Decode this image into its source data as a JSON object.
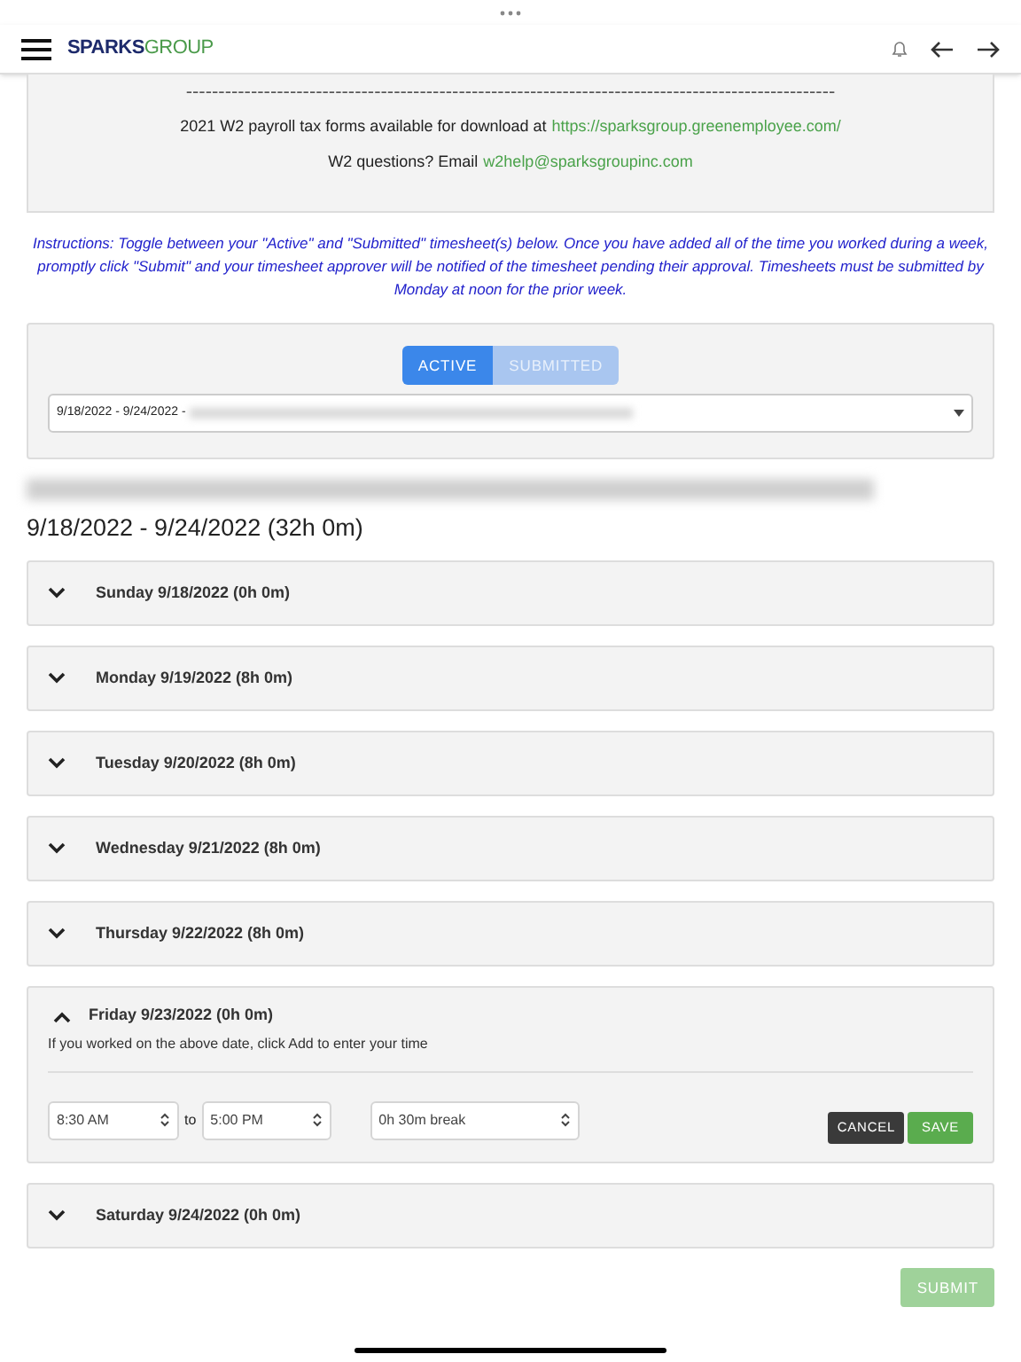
{
  "header": {
    "brand_bold": "SPARKS",
    "brand_light": "GROUP"
  },
  "notice": {
    "divider": "----------------------------------------------------------------------------------------------------",
    "line1": "2021 W2 payroll tax forms available for download at",
    "link1": "https://sparksgroup.greenemployee.com/",
    "line2": "W2 questions? Email",
    "link2": "w2help@sparksgroupinc.com"
  },
  "instructions": "Instructions: Toggle between your \"Active\" and \"Submitted\" timesheet(s) below. Once you have added all of the time you worked during a week, promptly click \"Submit\" and your timesheet approver will be notified of the timesheet pending their approval. Timesheets must be submitted by Monday at noon for the prior week.",
  "tabs": [
    {
      "label": "ACTIVE",
      "selected": true
    },
    {
      "label": "SUBMITTED",
      "selected": false
    }
  ],
  "timesheet_select": {
    "value": "9/18/2022 - 9/24/2022 -"
  },
  "period": "9/18/2022 - 9/24/2022 (32h 0m)",
  "days": [
    {
      "label": "Sunday 9/18/2022 (0h 0m)",
      "expanded": false
    },
    {
      "label": "Monday 9/19/2022 (8h 0m)",
      "expanded": false
    },
    {
      "label": "Tuesday 9/20/2022 (8h 0m)",
      "expanded": false
    },
    {
      "label": "Wednesday 9/21/2022 (8h 0m)",
      "expanded": false
    },
    {
      "label": "Thursday 9/22/2022 (8h 0m)",
      "expanded": false
    },
    {
      "label": "Friday 9/23/2022 (0h 0m)",
      "expanded": true,
      "hint": "If you worked on the above date, click Add to enter your time",
      "start": "8:30 AM",
      "to": "to",
      "end": "5:00 PM",
      "break": "0h 30m break",
      "cancel": "CANCEL",
      "save": "SAVE"
    },
    {
      "label": "Saturday 9/24/2022 (0h 0m)",
      "expanded": false
    }
  ],
  "submit": {
    "label": "SUBMIT",
    "disabled": true
  }
}
